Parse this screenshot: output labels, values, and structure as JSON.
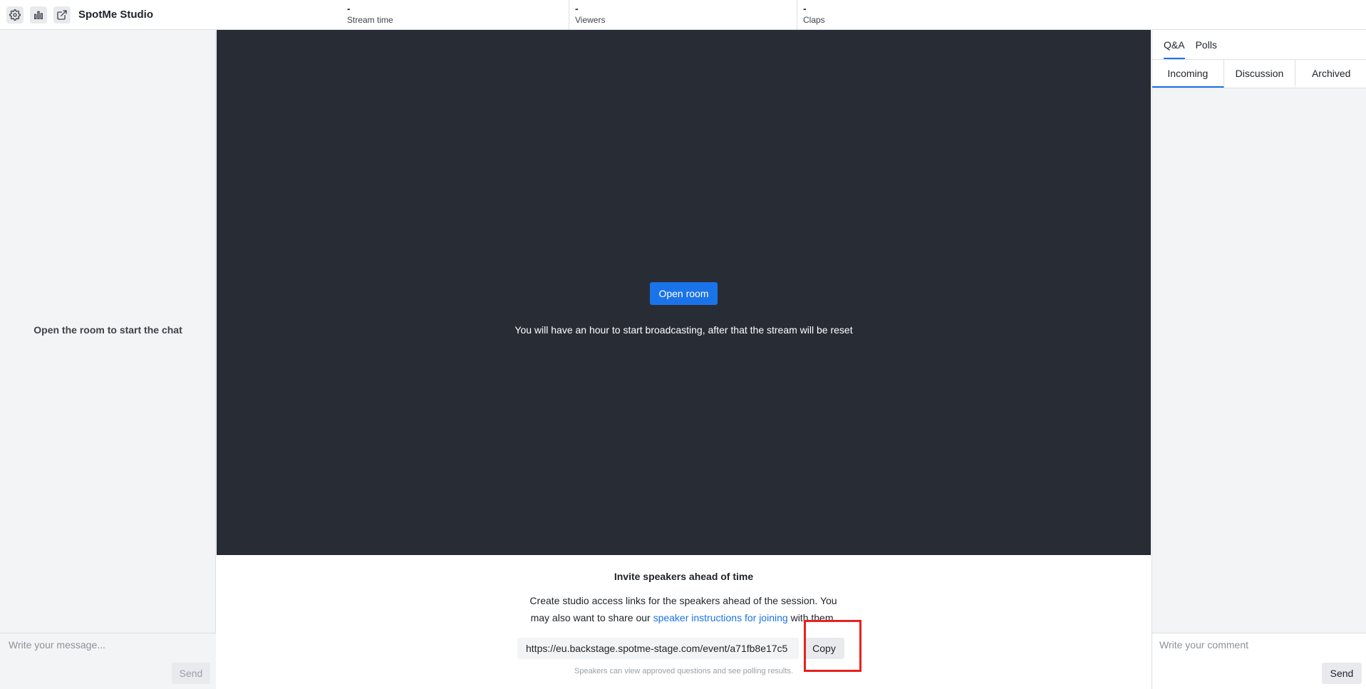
{
  "app": {
    "title": "SpotMe Studio",
    "icons": [
      "gear-icon",
      "bar-chart-icon",
      "external-link-icon"
    ]
  },
  "stats": [
    {
      "value": "-",
      "label": "Stream time"
    },
    {
      "value": "-",
      "label": "Viewers"
    },
    {
      "value": "-",
      "label": "Claps"
    }
  ],
  "chat": {
    "empty_message": "Open the room to start the chat",
    "input_placeholder": "Write your message...",
    "send_label": "Send"
  },
  "stage": {
    "open_room_label": "Open room",
    "note": "You will have an hour to start broadcasting, after that the stream will be reset"
  },
  "invite": {
    "title": "Invite speakers ahead of time",
    "desc_before": "Create studio access links for the speakers ahead of the session. You may also want to share our ",
    "desc_link": "speaker instructions for joining",
    "desc_after": " with them.",
    "link_value": "https://eu.backstage.spotme-stage.com/event/a71fb8e17c5",
    "copy_label": "Copy",
    "hint": "Speakers can view approved questions and see polling results."
  },
  "right_panel": {
    "main_tabs": [
      {
        "label": "Q&A",
        "active": true
      },
      {
        "label": "Polls",
        "active": false
      }
    ],
    "sub_tabs": [
      {
        "label": "Incoming",
        "active": true
      },
      {
        "label": "Discussion",
        "active": false
      },
      {
        "label": "Archived",
        "active": false
      }
    ],
    "comment_placeholder": "Write your comment",
    "send_label": "Send"
  },
  "colors": {
    "accent": "#1a73e8",
    "stage_bg": "#282c34",
    "panel_bg": "#f3f4f6",
    "highlight": "#e8211d"
  }
}
